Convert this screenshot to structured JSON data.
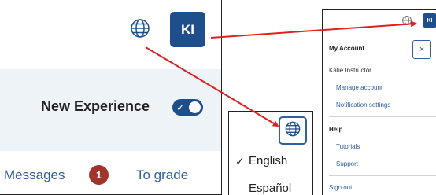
{
  "main": {
    "avatar_initials": "KI",
    "new_experience_label": "New Experience",
    "tabs": [
      {
        "label": "Messages",
        "badge": "1"
      },
      {
        "label": "To grade"
      }
    ]
  },
  "language_menu": {
    "options": [
      {
        "label": "English",
        "selected": true
      },
      {
        "label": "Español",
        "selected": false
      }
    ]
  },
  "account_menu": {
    "avatar_initials": "KI",
    "title": "My Account",
    "close_label": "×",
    "user_name": "Katie Instructor",
    "links": [
      "Manage account",
      "Notification settings"
    ],
    "help_heading": "Help",
    "help_links": [
      "Tutorials",
      "Support"
    ],
    "sign_out": "Sign out"
  },
  "colors": {
    "brand_blue": "#1f4e8c",
    "link_blue": "#2f5f9e",
    "badge_red": "#a2352a",
    "arrow_red": "#e02020",
    "highlight_bg": "#eef3f8"
  },
  "icons": [
    "globe-icon",
    "checkmark-icon",
    "close-icon"
  ]
}
